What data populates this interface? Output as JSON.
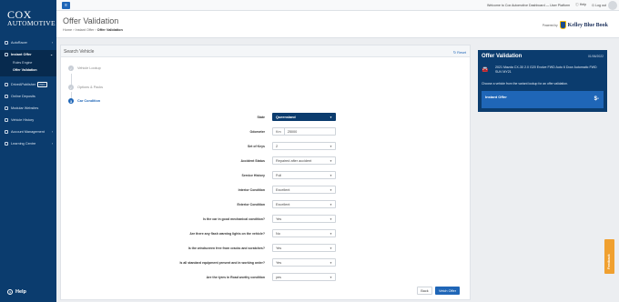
{
  "brand": {
    "logo_line1": "COX",
    "logo_line2": "AUTOMOTIVE"
  },
  "sidebar": {
    "items": [
      {
        "label": "AutoRacer",
        "chev": "›"
      },
      {
        "label": "Instant Offer",
        "chev": "⌄"
      }
    ],
    "sub_items": [
      {
        "label": "Rules Engine"
      },
      {
        "label": "Offer Validation"
      }
    ],
    "more_items": [
      {
        "label": "DriveAPublisher",
        "badge": "PRO"
      },
      {
        "label": "Online Deposits"
      },
      {
        "label": "Modular Websites"
      },
      {
        "label": "Vehicle History"
      },
      {
        "label": "Account Management",
        "chev": "›"
      },
      {
        "label": "Learning Centre",
        "chev": "›"
      }
    ],
    "help_label": "Help"
  },
  "topbar": {
    "welcome": "Welcome to Cox Automotive Dashboard — User Platform",
    "help": "Help",
    "logout": "Log out"
  },
  "header": {
    "title": "Offer Validation",
    "breadcrumb": [
      "Home",
      "Instant Offer",
      "Offer Validation"
    ],
    "powered_by": "Powered by",
    "kbb": "Kelley Blue Book"
  },
  "card": {
    "title": "Search Vehicle",
    "reset": "Reset",
    "steps": [
      {
        "label": "Vehicle Lookup",
        "mark": "✓"
      },
      {
        "label": "Options & Packs",
        "mark": "✓"
      },
      {
        "label": "Car Condition",
        "mark": "3"
      }
    ]
  },
  "form": [
    {
      "label": "State",
      "value": "Queensland",
      "kind": "state"
    },
    {
      "label": "Odometer",
      "prefix": "Km",
      "value": "25000",
      "kind": "odo"
    },
    {
      "label": "Set of Keys",
      "value": "2"
    },
    {
      "label": "Accident Status",
      "value": "Repaired after accident"
    },
    {
      "label": "Service History",
      "value": "Full"
    },
    {
      "label": "Interior Condition",
      "value": "Excellent"
    },
    {
      "label": "Exterior Condition",
      "value": "Excellent"
    },
    {
      "label": "Is the car in good mechanical condition?",
      "value": "Yes"
    },
    {
      "label": "Are there any flash warning lights on the vehicle?",
      "value": "No"
    },
    {
      "label": "Is the windscreen free from cracks and scratches?",
      "value": "Yes"
    },
    {
      "label": "Is all standard equipment present and in working order?",
      "value": "Yes"
    },
    {
      "label": "Are the tyres in Road worthy condition",
      "value": "yes"
    }
  ],
  "buttons": {
    "back": "Back",
    "vetch": "Vetch Offer"
  },
  "panel": {
    "title": "Offer Validation",
    "date": "01/06/2022",
    "vehicle": "2021 Mazda CX-30 2.0 G20 Evolve FWD Auto 6 Door Automatic FWD SUV MY21",
    "message": "Choose a vehicle from the variant lookup for an offer validation.",
    "offer_label": "Instant Offer",
    "offer_value": "$-"
  },
  "feedback": "Feedback"
}
